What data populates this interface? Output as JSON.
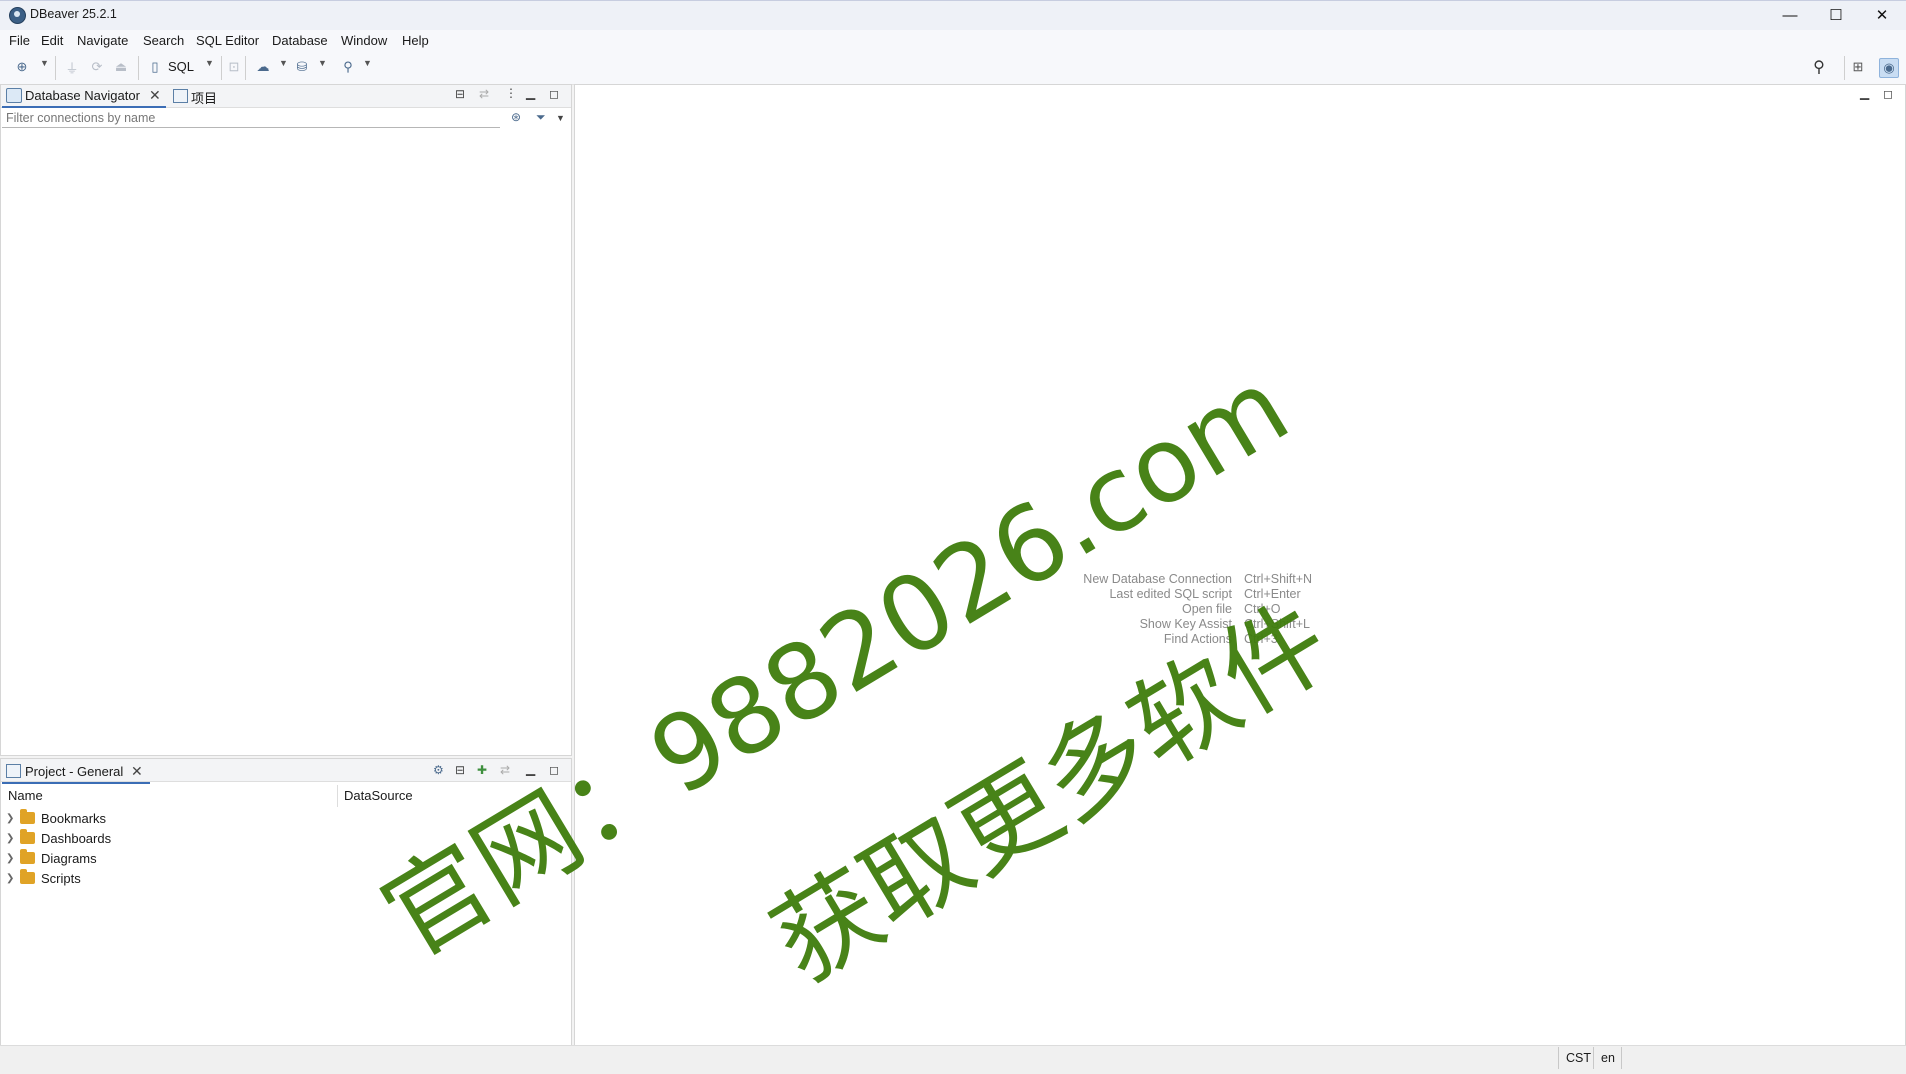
{
  "window": {
    "title": "DBeaver 25.2.1",
    "minimize": "—",
    "maximize": "☐",
    "close": "✕"
  },
  "menu": [
    "File",
    "Edit",
    "Navigate",
    "Search",
    "SQL Editor",
    "Database",
    "Window",
    "Help"
  ],
  "toolbar": {
    "sql_label": "SQL"
  },
  "navigator": {
    "tab_label": "Database Navigator",
    "second_tab_label": "项目",
    "filter_placeholder": "Filter connections by name"
  },
  "project": {
    "tab_label": "Project - General",
    "columns": [
      "Name",
      "DataSource"
    ],
    "items": [
      "Bookmarks",
      "Dashboards",
      "Diagrams",
      "Scripts"
    ]
  },
  "editor_hints": [
    {
      "action": "New Database Connection",
      "shortcut": "Ctrl+Shift+N"
    },
    {
      "action": "Last edited SQL script",
      "shortcut": "Ctrl+Enter"
    },
    {
      "action": "Open file",
      "shortcut": "Ctrl+O"
    },
    {
      "action": "Show Key Assist",
      "shortcut": "Ctrl+Shift+L"
    },
    {
      "action": "Find Actions",
      "shortcut": "Ctrl+3"
    }
  ],
  "status": {
    "timezone": "CST",
    "locale": "en"
  },
  "watermark": {
    "line1": "官网：9882026.com",
    "line2": "获取更多软件"
  },
  "colors": {
    "accent": "#3b6db5",
    "watermark": "#3f7d0c",
    "folder": "#e0a326"
  }
}
